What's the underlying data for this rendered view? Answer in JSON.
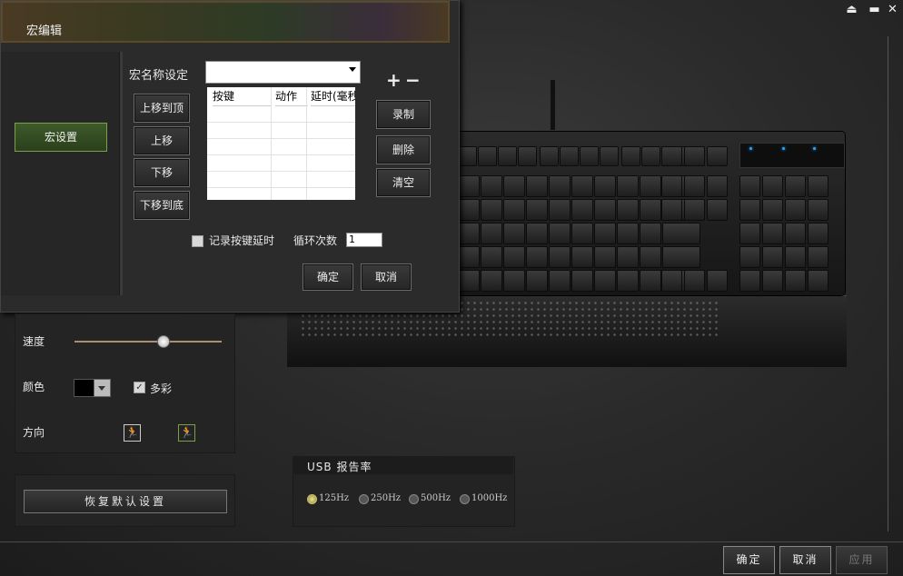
{
  "window": {
    "controls": [
      "eject-icon",
      "minimize-icon",
      "close-icon"
    ]
  },
  "macro_editor": {
    "title": "宏编辑",
    "macro_settings_button": "宏设置",
    "name_label": "宏名称设定",
    "name_value": "",
    "move_top": "上移到顶",
    "move_up": "上移",
    "move_down": "下移",
    "move_bottom": "下移到底",
    "table_headers": [
      "按键",
      "动作",
      "延时(毫秒"
    ],
    "plus": "+",
    "minus": "−",
    "record": "录制",
    "delete": "删除",
    "clear": "清空",
    "record_delay_label": "记录按键延时",
    "loop_label": "循环次数",
    "loop_value": "1",
    "ok": "确定",
    "cancel": "取消"
  },
  "lighting": {
    "speed_label": "速度",
    "speed_value": 0.6,
    "color_label": "颜色",
    "color_value": "#000000",
    "multicolor_label": "多彩",
    "multicolor_checked": true,
    "direction_label": "方向"
  },
  "reset_label": "恢复默认设置",
  "usb": {
    "title": "USB 报告率",
    "options": [
      "125Hz",
      "250Hz",
      "500Hz",
      "1000Hz"
    ],
    "selected": "125Hz"
  },
  "footer": {
    "ok": "确定",
    "cancel": "取消",
    "apply": "应用"
  },
  "colors": {
    "accent_green": "#7aa04a",
    "led_blue": "#27a9ff"
  }
}
